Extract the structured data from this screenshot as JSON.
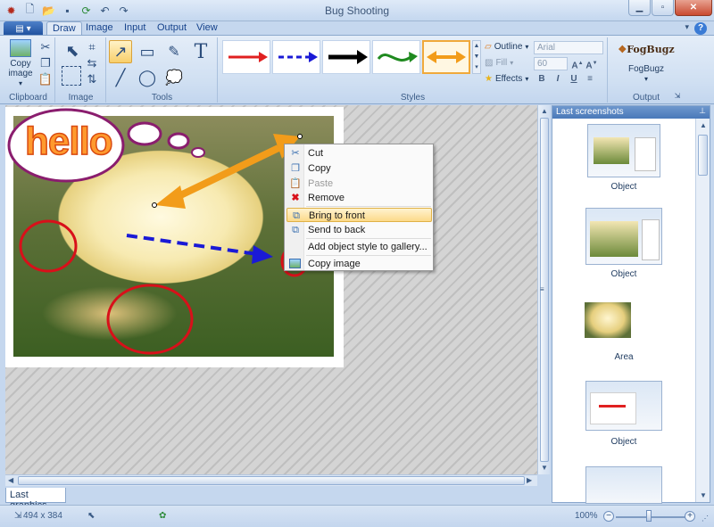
{
  "window": {
    "title": "Bug Shooting"
  },
  "tabs": [
    "Draw",
    "Image",
    "Input",
    "Output",
    "View"
  ],
  "ribbon": {
    "clipboard": {
      "copy_image_label": "Copy image",
      "group_label": "Clipboard"
    },
    "image": {
      "group_label": "Image"
    },
    "tools": {
      "group_label": "Tools"
    },
    "styles": {
      "group_label": "Styles",
      "outline_label": "Outline",
      "fill_label": "Fill",
      "effects_label": "Effects",
      "font_placeholder": "Arial",
      "size_placeholder": "60",
      "bold": "B",
      "italic": "I",
      "underline": "U",
      "arrows": [
        {
          "color": "#e02020",
          "style": "solid"
        },
        {
          "color": "#1a1ad6",
          "style": "dashed"
        },
        {
          "color": "#000000",
          "style": "solid"
        },
        {
          "color": "#1f8a1f",
          "style": "curve"
        },
        {
          "color": "#f29c1a",
          "style": "double"
        }
      ]
    },
    "output": {
      "fogbugz_logo": "FogBugz",
      "fogbugz_label": "FogBugz",
      "group_label": "Output"
    }
  },
  "canvas": {
    "bubble_text": "hello"
  },
  "context_menu": {
    "items": [
      {
        "label": "Cut",
        "icon": "scissors-icon",
        "disabled": false
      },
      {
        "label": "Copy",
        "icon": "copy-icon",
        "disabled": false
      },
      {
        "label": "Paste",
        "icon": "paste-icon",
        "disabled": true
      },
      {
        "label": "Remove",
        "icon": "remove-icon",
        "disabled": false
      },
      {
        "label": "Bring to front",
        "icon": "bring-front-icon",
        "disabled": false,
        "highlighted": true
      },
      {
        "label": "Send to back",
        "icon": "send-back-icon",
        "disabled": false
      },
      {
        "label": "Add object style to gallery...",
        "icon": "",
        "disabled": false
      },
      {
        "label": "Copy image",
        "icon": "copy-image-icon",
        "disabled": false
      }
    ]
  },
  "bottom_tab": {
    "label": "Last graphics"
  },
  "panel": {
    "title": "Last screenshots",
    "items": [
      {
        "caption": "Object"
      },
      {
        "caption": "Object"
      },
      {
        "caption": "Area"
      },
      {
        "caption": "Object"
      },
      {
        "caption": ""
      }
    ]
  },
  "statusbar": {
    "dimensions": "494 x 384",
    "zoom": "100%"
  }
}
